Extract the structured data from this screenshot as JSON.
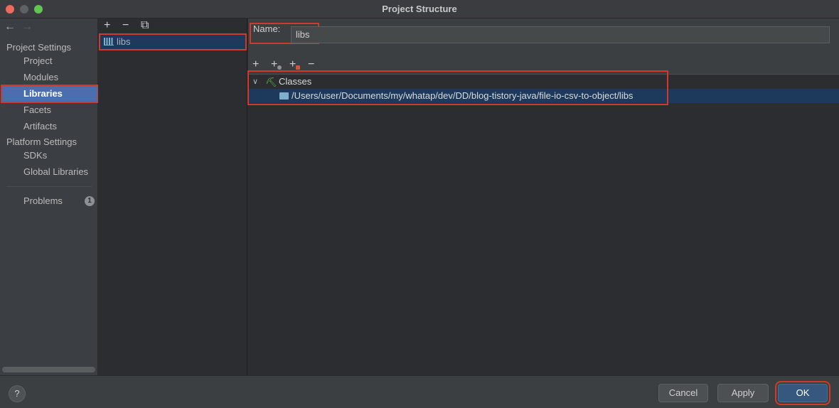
{
  "window": {
    "title": "Project Structure"
  },
  "nav": {
    "back_icon": "←",
    "forward_icon": "→"
  },
  "sidebar": {
    "project_settings_header": "Project Settings",
    "project_items": [
      "Project",
      "Modules",
      "Libraries",
      "Facets",
      "Artifacts"
    ],
    "selected": "Libraries",
    "platform_settings_header": "Platform Settings",
    "platform_items": [
      "SDKs",
      "Global Libraries"
    ],
    "problems_label": "Problems",
    "problems_count": "1"
  },
  "libraries_toolbar": {
    "add_icon": "+",
    "remove_icon": "−",
    "copy_icon": "⧉"
  },
  "libraries": [
    {
      "name": "libs"
    }
  ],
  "detail": {
    "name_label": "Name:",
    "name_value": "libs",
    "toolbar": {
      "add_icon": "+",
      "add_alt_icon": "+",
      "add_jar_icon": "+",
      "remove_icon": "−"
    },
    "tree": {
      "expand_icon": "∨",
      "node_label": "Classes",
      "node_icon": "⛏",
      "child_path": "/Users/user/Documents/my/whatap/dev/DD/blog-tistory-java/file-io-csv-to-object/libs"
    }
  },
  "buttons": {
    "help": "?",
    "cancel": "Cancel",
    "apply": "Apply",
    "ok": "OK"
  },
  "colors": {
    "accent_selected": "#4b6eaf",
    "highlight_box": "#d13a2a",
    "ok_button": "#365880"
  }
}
